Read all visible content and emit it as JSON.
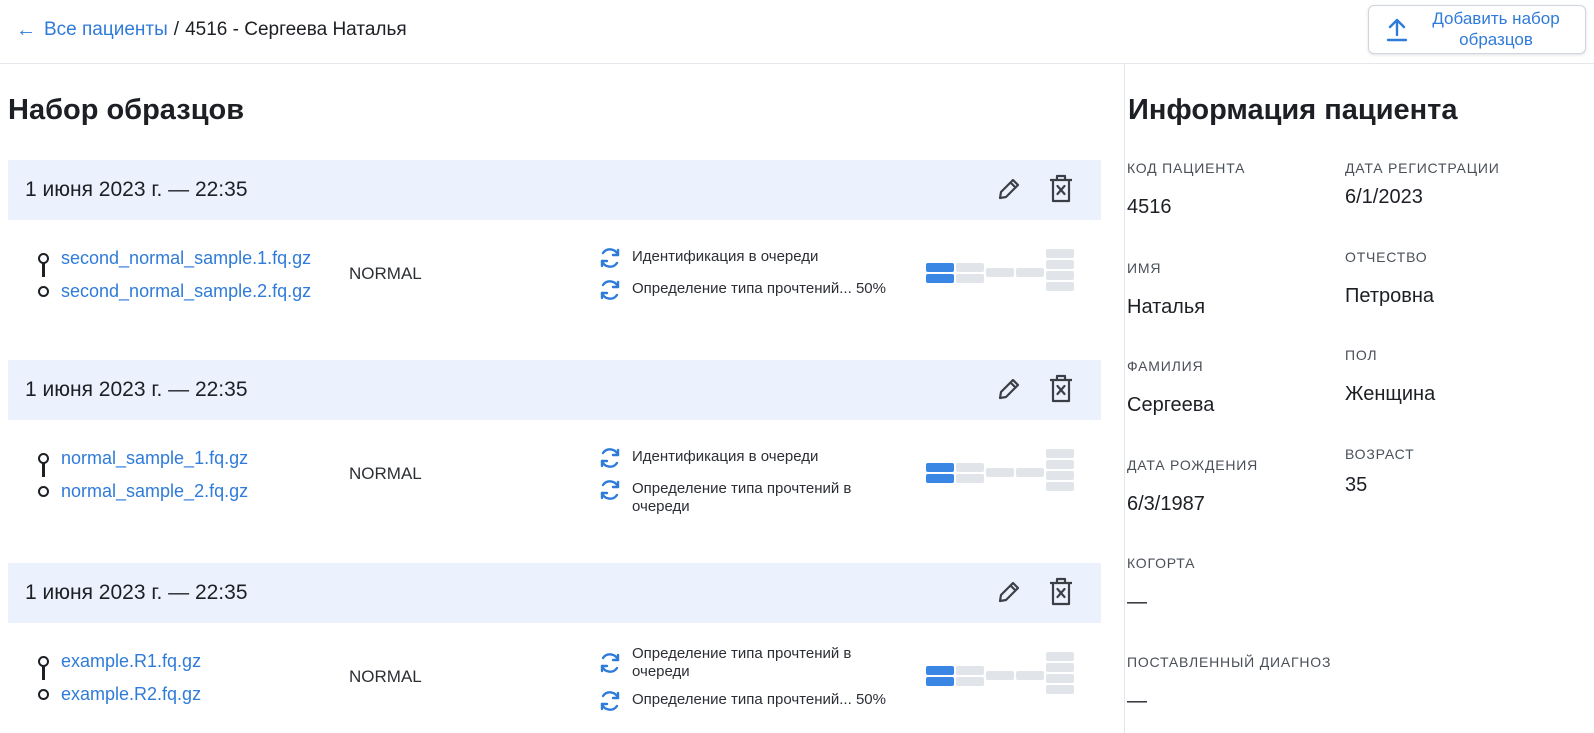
{
  "header": {
    "back_arrow": "←",
    "breadcrumb_link": "Все пациенты",
    "breadcrumb_sep": "/",
    "breadcrumb_current": "4516 - Сергеева Наталья",
    "add_button_label": "Добавить набор\nобразцов"
  },
  "samples": {
    "title": "Набор образцов",
    "sets": [
      {
        "date": "1 июня 2023 г. — 22:35",
        "files": [
          "second_normal_sample.1.fq.gz",
          "second_normal_sample.2.fq.gz"
        ],
        "type": "NORMAL",
        "statuses": [
          "Идентификация в очереди",
          "Определение типа прочтений... 50%"
        ]
      },
      {
        "date": "1 июня 2023 г. — 22:35",
        "files": [
          "normal_sample_1.fq.gz",
          "normal_sample_2.fq.gz"
        ],
        "type": "NORMAL",
        "statuses": [
          "Идентификация в очереди",
          "Определение типа прочтений в очереди"
        ]
      },
      {
        "date": "1 июня 2023 г. — 22:35",
        "files": [
          "example.R1.fq.gz",
          "example.R2.fq.gz"
        ],
        "type": "NORMAL",
        "statuses": [
          "Определение типа прочтений в очереди",
          "Определение типа прочтений... 50%"
        ]
      }
    ]
  },
  "patient": {
    "title": "Информация пациента",
    "code_label": "Код пациента",
    "code": "4516",
    "reg_date_label": "Дата регистрации",
    "reg_date": "6/1/2023",
    "first_name_label": "Имя",
    "first_name": "Наталья",
    "patronymic_label": "Отчество",
    "patronymic": "Петровна",
    "last_name_label": "Фамилия",
    "last_name": "Сергеева",
    "sex_label": "Пол",
    "sex": "Женщина",
    "birth_date_label": "Дата рождения",
    "birth_date": "6/3/1987",
    "age_label": "Возраст",
    "age": "35",
    "cohort_label": "Когорта",
    "cohort": "—",
    "diagnosis_label": "Поставленный диагноз",
    "diagnosis": "—"
  },
  "colors": {
    "accent": "#2f7bd9",
    "set_header_bg": "#ebf2fd",
    "progress_on": "#3a86e4",
    "progress_off": "#e1e5ea"
  }
}
